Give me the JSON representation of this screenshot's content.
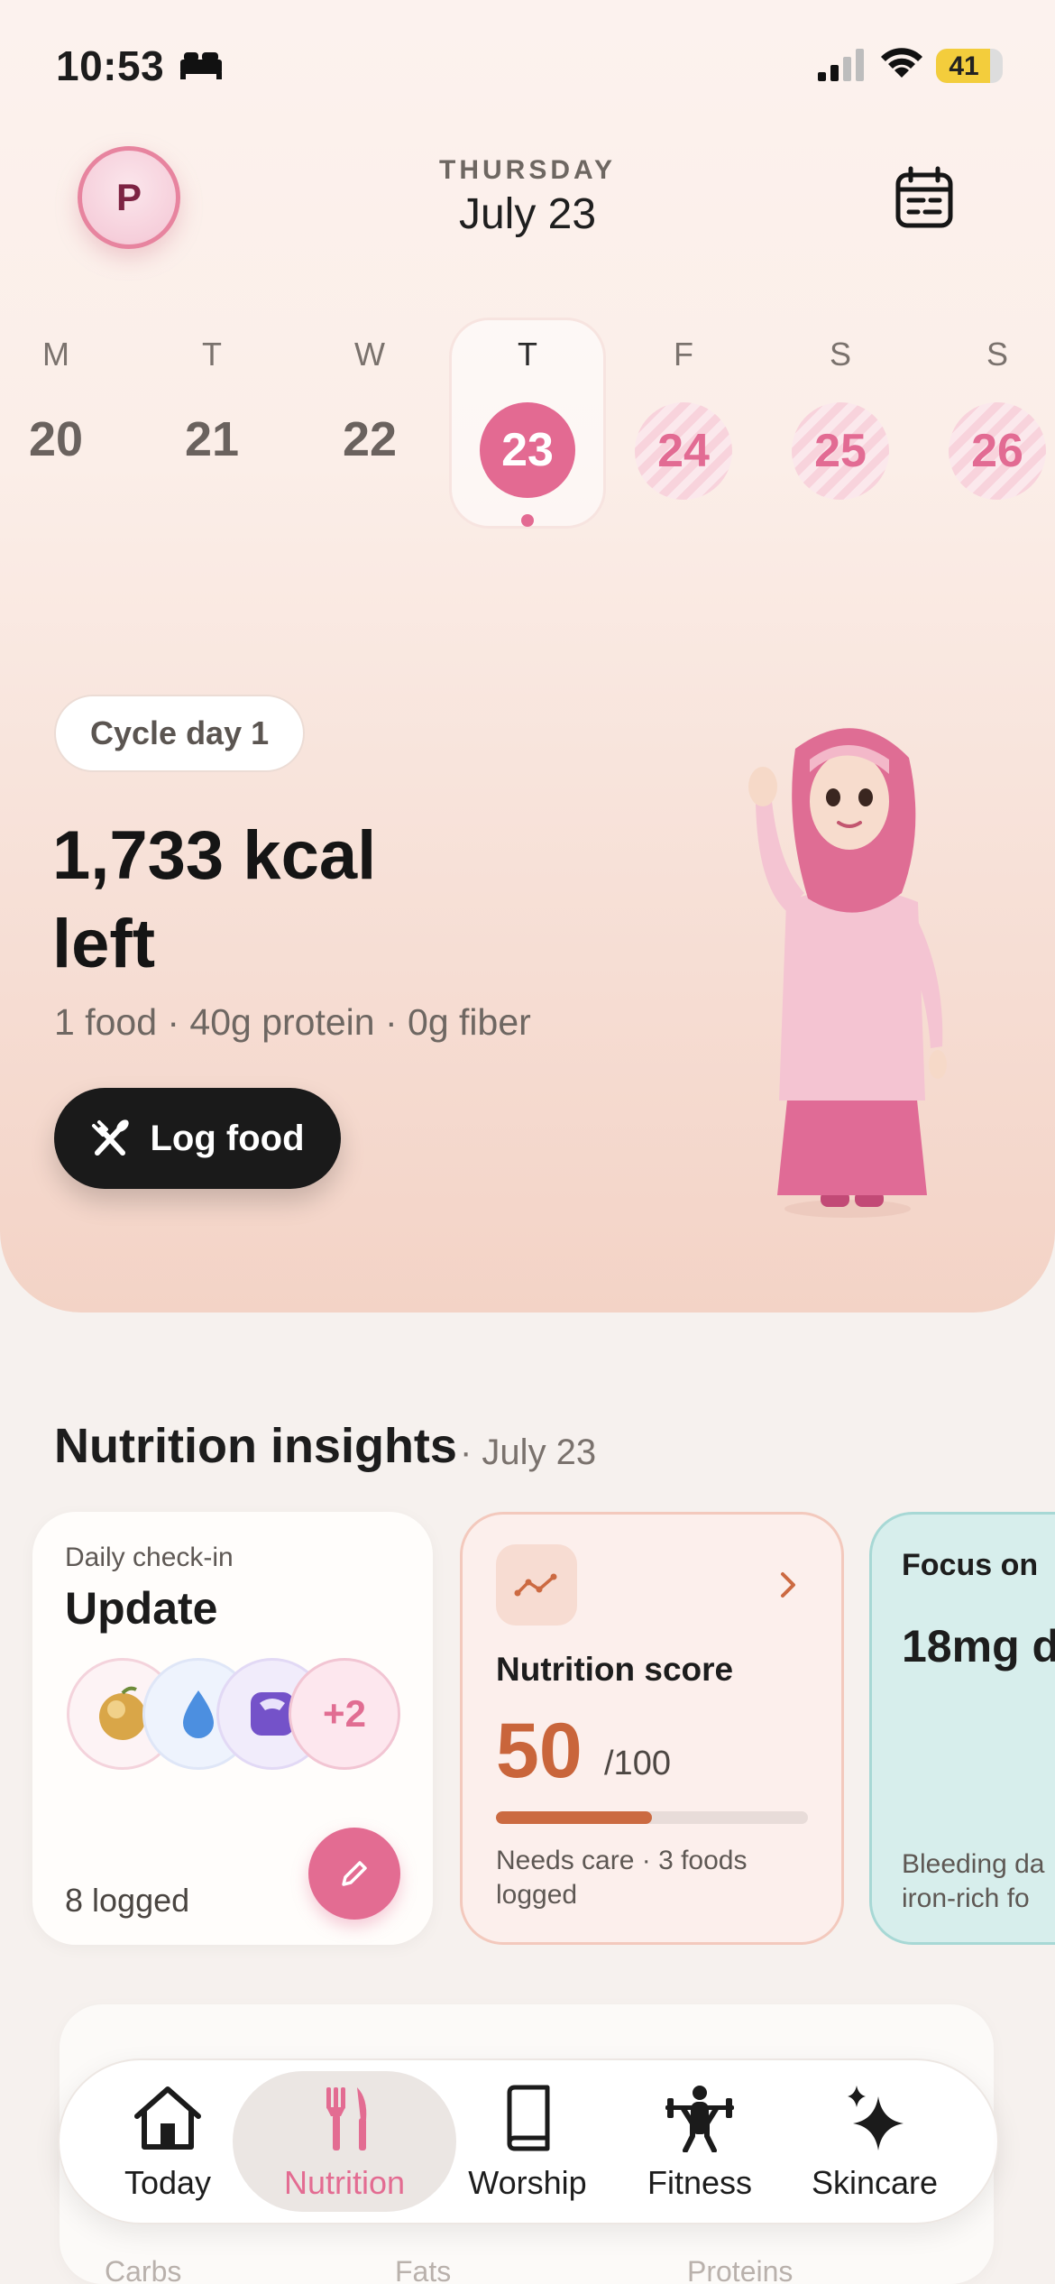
{
  "status_bar": {
    "time": "10:53",
    "battery": "41"
  },
  "header": {
    "avatar_initial": "P",
    "weekday": "THURSDAY",
    "date": "July 23"
  },
  "week": [
    {
      "letter": "M",
      "num": "20",
      "state": "past"
    },
    {
      "letter": "T",
      "num": "21",
      "state": "past"
    },
    {
      "letter": "W",
      "num": "22",
      "state": "past"
    },
    {
      "letter": "T",
      "num": "23",
      "state": "selected"
    },
    {
      "letter": "F",
      "num": "24",
      "state": "future"
    },
    {
      "letter": "S",
      "num": "25",
      "state": "future"
    },
    {
      "letter": "S",
      "num": "26",
      "state": "future"
    }
  ],
  "hero": {
    "cycle_label": "Cycle day 1",
    "kcal_line1": "1,733 kcal",
    "kcal_line2": "left",
    "summary": "1 food · 40g protein · 0g fiber",
    "log_button": "Log food"
  },
  "insights": {
    "title": "Nutrition insights",
    "date": "· July 23",
    "checkin": {
      "label": "Daily check-in",
      "title": "Update",
      "more": "+2",
      "logged": "8 logged"
    },
    "score": {
      "title": "Nutrition score",
      "value": "50",
      "max": "/100",
      "progress": 0.5,
      "foot": "Needs care · 3 foods logged"
    },
    "focus": {
      "title": "Focus on",
      "value": "18mg d",
      "foot1": "Bleeding da",
      "foot2": "iron-rich fo"
    }
  },
  "peek": {
    "labels": [
      "Carbs",
      "Fats",
      "Proteins"
    ]
  },
  "tabs": [
    {
      "label": "Today",
      "icon": "home-icon",
      "active": false
    },
    {
      "label": "Nutrition",
      "icon": "fork-knife-icon",
      "active": true
    },
    {
      "label": "Worship",
      "icon": "book-icon",
      "active": false
    },
    {
      "label": "Fitness",
      "icon": "weightlifter-icon",
      "active": false
    },
    {
      "label": "Skincare",
      "icon": "sparkle-icon",
      "active": false
    }
  ],
  "colors": {
    "accent": "#e36c92",
    "score": "#cb6a41",
    "focus_bg": "#d7eeec"
  }
}
